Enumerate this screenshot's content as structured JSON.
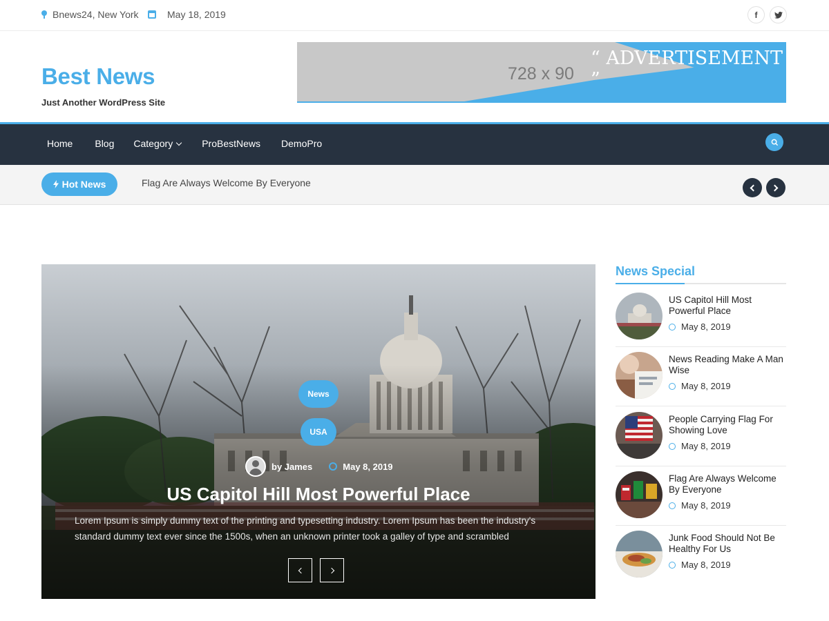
{
  "topbar": {
    "location": "Bnews24, New York",
    "date": "May 18, 2019",
    "social": [
      {
        "icon": "facebook-icon",
        "glyph": "f"
      },
      {
        "icon": "twitter-icon",
        "glyph": "t"
      }
    ]
  },
  "header": {
    "site_title": "Best News",
    "tagline": "Just Another WordPress Site",
    "ad": {
      "size_text": "728 x 90",
      "label": "“ ADVERTISEMENT ”"
    }
  },
  "nav": {
    "items": [
      {
        "label": "Home"
      },
      {
        "label": "Blog"
      },
      {
        "label": "Category",
        "dropdown": true
      },
      {
        "label": "ProBestNews"
      },
      {
        "label": "DemoPro"
      }
    ],
    "search_icon": "search-icon"
  },
  "ticker": {
    "badge": "Hot News",
    "headline": "Flag Are Always Welcome By Everyone"
  },
  "hero": {
    "categories": [
      "News",
      "USA"
    ],
    "author": "by James",
    "date": "May 8, 2019",
    "title": "US Capitol Hill Most Powerful Place",
    "excerpt": "Lorem Ipsum is simply dummy text of the printing and typesetting industry. Lorem Ipsum has been the industry's standard dummy text ever since the 1500s, when an unknown printer took a galley of type and scrambled"
  },
  "sidebar": {
    "title": "News Special",
    "posts": [
      {
        "title": "US Capitol Hill Most Powerful Place",
        "date": "May 8, 2019"
      },
      {
        "title": "News Reading Make A Man Wise",
        "date": "May 8, 2019"
      },
      {
        "title": "People Carrying Flag For Showing Love",
        "date": "May 8, 2019"
      },
      {
        "title": "Flag Are Always Welcome By Everyone",
        "date": "May 8, 2019"
      },
      {
        "title": "Junk Food Should Not Be Healthy For Us",
        "date": "May 8, 2019"
      }
    ]
  },
  "colors": {
    "accent": "#4aaee8",
    "nav_bg": "#273240"
  }
}
